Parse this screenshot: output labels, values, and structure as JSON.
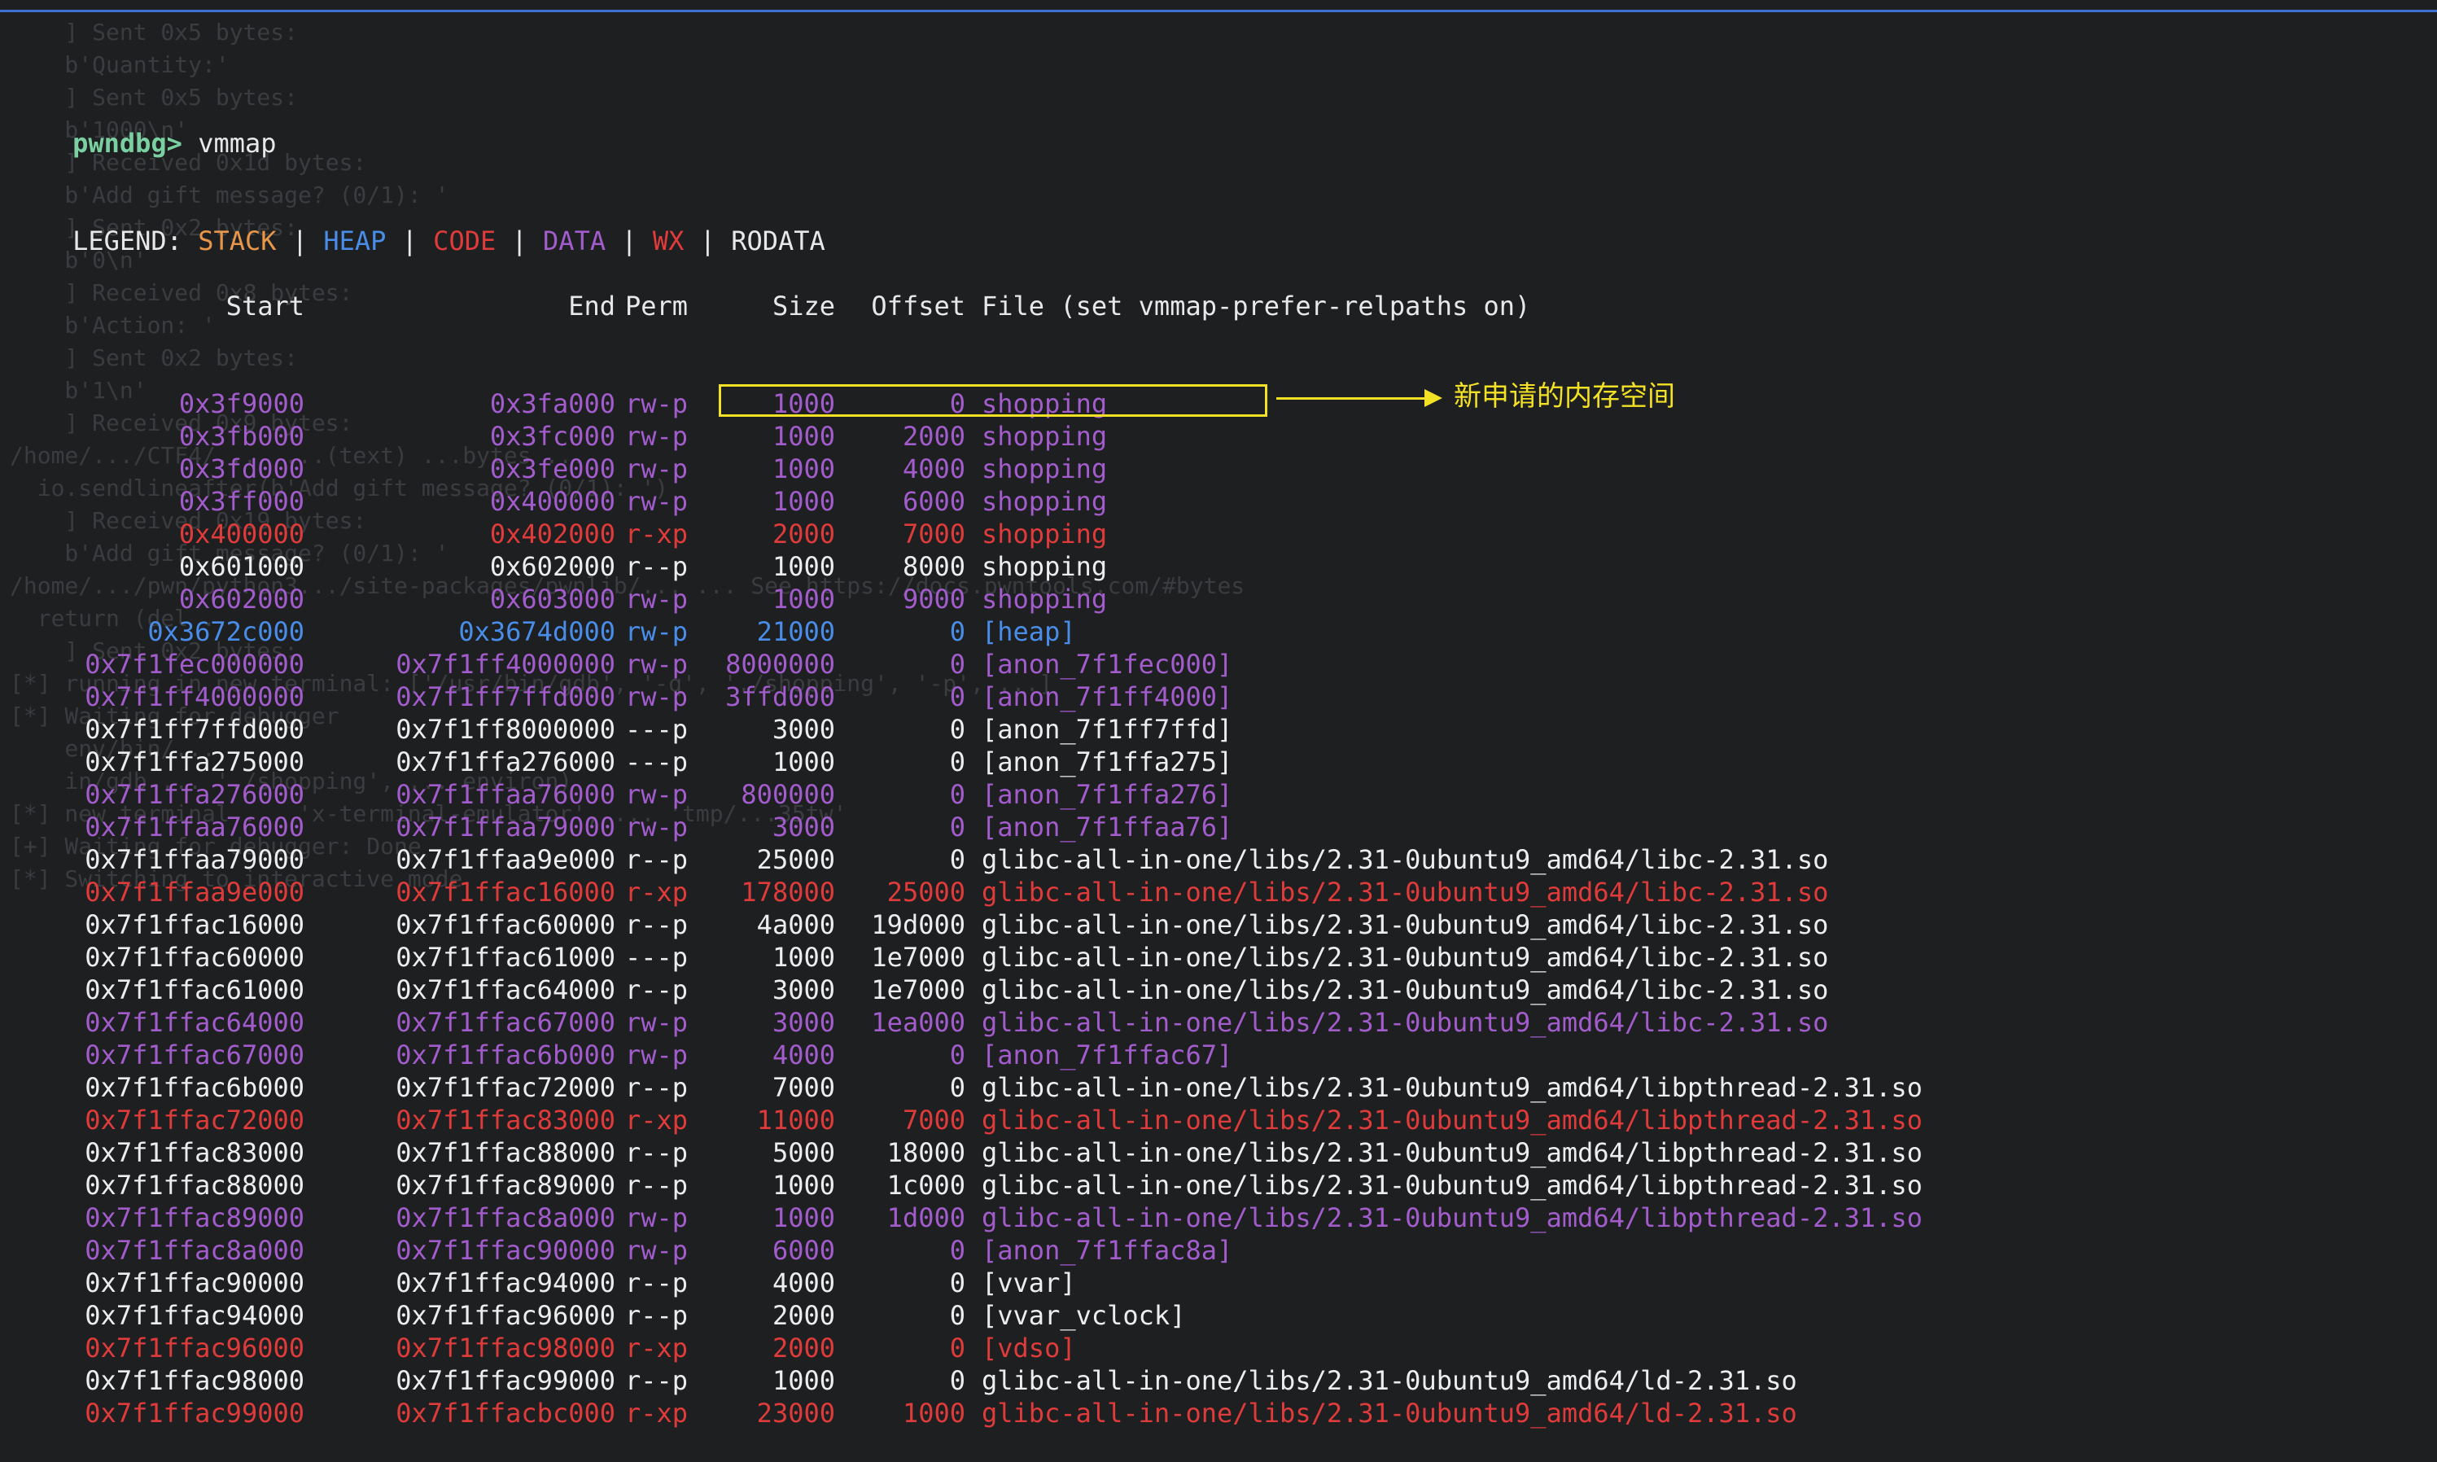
{
  "prompt": {
    "label": "pwndbg>",
    "command": "vmmap"
  },
  "legend": {
    "label": "LEGEND:",
    "sep": "|",
    "stack": "STACK",
    "heap": "HEAP",
    "code": "CODE",
    "data": "DATA",
    "wx": "WX",
    "rodata": "RODATA"
  },
  "header": {
    "start": "Start",
    "end": "End",
    "perm": "Perm",
    "size": "Size",
    "offset": "Offset",
    "file": "File (set vmmap-prefer-relpaths on)"
  },
  "rows": [
    {
      "start": "0x3f9000",
      "end": "0x3fa000",
      "perm": "rw-p",
      "size": "1000",
      "offset": "0",
      "file": "shopping",
      "type": "data"
    },
    {
      "start": "0x3fb000",
      "end": "0x3fc000",
      "perm": "rw-p",
      "size": "1000",
      "offset": "2000",
      "file": "shopping",
      "type": "data"
    },
    {
      "start": "0x3fd000",
      "end": "0x3fe000",
      "perm": "rw-p",
      "size": "1000",
      "offset": "4000",
      "file": "shopping",
      "type": "data"
    },
    {
      "start": "0x3ff000",
      "end": "0x400000",
      "perm": "rw-p",
      "size": "1000",
      "offset": "6000",
      "file": "shopping",
      "type": "data"
    },
    {
      "start": "0x400000",
      "end": "0x402000",
      "perm": "r-xp",
      "size": "2000",
      "offset": "7000",
      "file": "shopping",
      "type": "code"
    },
    {
      "start": "0x601000",
      "end": "0x602000",
      "perm": "r--p",
      "size": "1000",
      "offset": "8000",
      "file": "shopping",
      "type": "rodata"
    },
    {
      "start": "0x602000",
      "end": "0x603000",
      "perm": "rw-p",
      "size": "1000",
      "offset": "9000",
      "file": "shopping",
      "type": "data"
    },
    {
      "start": "0x3672c000",
      "end": "0x3674d000",
      "perm": "rw-p",
      "size": "21000",
      "offset": "0",
      "file": "[heap]",
      "type": "heap"
    },
    {
      "start": "0x7f1fec000000",
      "end": "0x7f1ff4000000",
      "perm": "rw-p",
      "size": "8000000",
      "offset": "0",
      "file": "[anon_7f1fec000]",
      "type": "data"
    },
    {
      "start": "0x7f1ff4000000",
      "end": "0x7f1ff7ffd000",
      "perm": "rw-p",
      "size": "3ffd000",
      "offset": "0",
      "file": "[anon_7f1ff4000]",
      "type": "data"
    },
    {
      "start": "0x7f1ff7ffd000",
      "end": "0x7f1ff8000000",
      "perm": "---p",
      "size": "3000",
      "offset": "0",
      "file": "[anon_7f1ff7ffd]",
      "type": "rodata"
    },
    {
      "start": "0x7f1ffa275000",
      "end": "0x7f1ffa276000",
      "perm": "---p",
      "size": "1000",
      "offset": "0",
      "file": "[anon_7f1ffa275]",
      "type": "rodata"
    },
    {
      "start": "0x7f1ffa276000",
      "end": "0x7f1ffaa76000",
      "perm": "rw-p",
      "size": "800000",
      "offset": "0",
      "file": "[anon_7f1ffa276]",
      "type": "data"
    },
    {
      "start": "0x7f1ffaa76000",
      "end": "0x7f1ffaa79000",
      "perm": "rw-p",
      "size": "3000",
      "offset": "0",
      "file": "[anon_7f1ffaa76]",
      "type": "data"
    },
    {
      "start": "0x7f1ffaa79000",
      "end": "0x7f1ffaa9e000",
      "perm": "r--p",
      "size": "25000",
      "offset": "0",
      "file": "glibc-all-in-one/libs/2.31-0ubuntu9_amd64/libc-2.31.so",
      "type": "rodata"
    },
    {
      "start": "0x7f1ffaa9e000",
      "end": "0x7f1ffac16000",
      "perm": "r-xp",
      "size": "178000",
      "offset": "25000",
      "file": "glibc-all-in-one/libs/2.31-0ubuntu9_amd64/libc-2.31.so",
      "type": "code"
    },
    {
      "start": "0x7f1ffac16000",
      "end": "0x7f1ffac60000",
      "perm": "r--p",
      "size": "4a000",
      "offset": "19d000",
      "file": "glibc-all-in-one/libs/2.31-0ubuntu9_amd64/libc-2.31.so",
      "type": "rodata"
    },
    {
      "start": "0x7f1ffac60000",
      "end": "0x7f1ffac61000",
      "perm": "---p",
      "size": "1000",
      "offset": "1e7000",
      "file": "glibc-all-in-one/libs/2.31-0ubuntu9_amd64/libc-2.31.so",
      "type": "rodata"
    },
    {
      "start": "0x7f1ffac61000",
      "end": "0x7f1ffac64000",
      "perm": "r--p",
      "size": "3000",
      "offset": "1e7000",
      "file": "glibc-all-in-one/libs/2.31-0ubuntu9_amd64/libc-2.31.so",
      "type": "rodata"
    },
    {
      "start": "0x7f1ffac64000",
      "end": "0x7f1ffac67000",
      "perm": "rw-p",
      "size": "3000",
      "offset": "1ea000",
      "file": "glibc-all-in-one/libs/2.31-0ubuntu9_amd64/libc-2.31.so",
      "type": "data"
    },
    {
      "start": "0x7f1ffac67000",
      "end": "0x7f1ffac6b000",
      "perm": "rw-p",
      "size": "4000",
      "offset": "0",
      "file": "[anon_7f1ffac67]",
      "type": "data"
    },
    {
      "start": "0x7f1ffac6b000",
      "end": "0x7f1ffac72000",
      "perm": "r--p",
      "size": "7000",
      "offset": "0",
      "file": "glibc-all-in-one/libs/2.31-0ubuntu9_amd64/libpthread-2.31.so",
      "type": "rodata"
    },
    {
      "start": "0x7f1ffac72000",
      "end": "0x7f1ffac83000",
      "perm": "r-xp",
      "size": "11000",
      "offset": "7000",
      "file": "glibc-all-in-one/libs/2.31-0ubuntu9_amd64/libpthread-2.31.so",
      "type": "code"
    },
    {
      "start": "0x7f1ffac83000",
      "end": "0x7f1ffac88000",
      "perm": "r--p",
      "size": "5000",
      "offset": "18000",
      "file": "glibc-all-in-one/libs/2.31-0ubuntu9_amd64/libpthread-2.31.so",
      "type": "rodata"
    },
    {
      "start": "0x7f1ffac88000",
      "end": "0x7f1ffac89000",
      "perm": "r--p",
      "size": "1000",
      "offset": "1c000",
      "file": "glibc-all-in-one/libs/2.31-0ubuntu9_amd64/libpthread-2.31.so",
      "type": "rodata"
    },
    {
      "start": "0x7f1ffac89000",
      "end": "0x7f1ffac8a000",
      "perm": "rw-p",
      "size": "1000",
      "offset": "1d000",
      "file": "glibc-all-in-one/libs/2.31-0ubuntu9_amd64/libpthread-2.31.so",
      "type": "data"
    },
    {
      "start": "0x7f1ffac8a000",
      "end": "0x7f1ffac90000",
      "perm": "rw-p",
      "size": "6000",
      "offset": "0",
      "file": "[anon_7f1ffac8a]",
      "type": "data"
    },
    {
      "start": "0x7f1ffac90000",
      "end": "0x7f1ffac94000",
      "perm": "r--p",
      "size": "4000",
      "offset": "0",
      "file": "[vvar]",
      "type": "rodata"
    },
    {
      "start": "0x7f1ffac94000",
      "end": "0x7f1ffac96000",
      "perm": "r--p",
      "size": "2000",
      "offset": "0",
      "file": "[vvar_vclock]",
      "type": "rodata"
    },
    {
      "start": "0x7f1ffac96000",
      "end": "0x7f1ffac98000",
      "perm": "r-xp",
      "size": "2000",
      "offset": "0",
      "file": "[vdso]",
      "type": "code"
    },
    {
      "start": "0x7f1ffac98000",
      "end": "0x7f1ffac99000",
      "perm": "r--p",
      "size": "1000",
      "offset": "0",
      "file": "glibc-all-in-one/libs/2.31-0ubuntu9_amd64/ld-2.31.so",
      "type": "rodata"
    },
    {
      "start": "0x7f1ffac99000",
      "end": "0x7f1ffacbc000",
      "perm": "r-xp",
      "size": "23000",
      "offset": "1000",
      "file": "glibc-all-in-one/libs/2.31-0ubuntu9_amd64/ld-2.31.so",
      "type": "code"
    }
  ],
  "annotation": {
    "text": "新申请的内存空间"
  },
  "background_lines": [
    "    ] Sent 0x5 bytes:",
    "    b'Quantity:'",
    "    ] Sent 0x5 bytes:",
    "    b'1000\\n'",
    "    ] Received 0x1d bytes:",
    "    b'Add gift message? (0/1): '",
    "    ] Sent 0x2 bytes:",
    "    b'0\\n'",
    "    ] Received 0x8 bytes:",
    "    b'Action: '",
    "    ] Sent 0x2 bytes:",
    "    b'1\\n'",
    "    ] Received 0x9 bytes:",
    "/home/.../CTF4/...  ...(text) ...bytes ...",
    "  io.sendlineafter(b'Add gift message? (0/1): ')",
    "    ] Received 0x19 bytes:",
    "    b'Add gift message? (0/1): '",
    "/home/.../pwn/python3.../site-packages/pwnlib/... ... See https://docs.pwntools.com/#bytes",
    "  return (del ...",
    "    ] Sent 0x2 bytes:",
    "[*] running in new terminal: ['/usr/bin/gdb', '-q', './shopping', '-p', ...]",
    "[*] Waiting for debugger",
    "    env/bin/...",
    "    in/gdb ... './shopping', ... environ)",
    "[*] new terminal ... 'x-terminal-emulator', ... 'tmp/...35tw'",
    "[+] Waiting for debugger: Done",
    "[*] Switching to interactive mode"
  ]
}
